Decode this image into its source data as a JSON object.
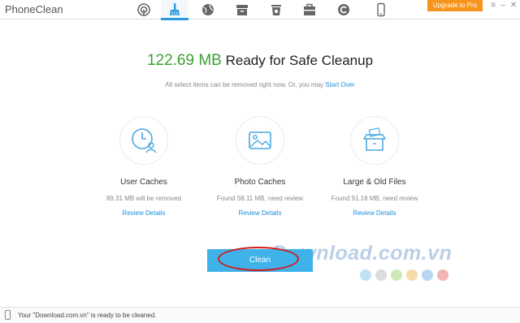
{
  "app": {
    "title": "PhoneClean",
    "upgrade_label": "Upgrade to Pro",
    "window_buttons": {
      "menu": "≡",
      "minimize": "–",
      "close": "✕"
    }
  },
  "toolbar": {
    "icons": [
      {
        "name": "scan-icon",
        "active": false
      },
      {
        "name": "broom-icon",
        "active": true
      },
      {
        "name": "globe-icon",
        "active": false
      },
      {
        "name": "archive-icon",
        "active": false
      },
      {
        "name": "trash-icon",
        "active": false
      },
      {
        "name": "toolbox-icon",
        "active": false
      },
      {
        "name": "refresh-icon",
        "active": false
      },
      {
        "name": "phone-icon",
        "active": false
      }
    ],
    "accent": "#2a9be0"
  },
  "summary": {
    "size": "122.69 MB",
    "headline": "Ready for Safe Cleanup",
    "subline": "All select items can be removed right now. Or, you may",
    "start_over": "Start Over",
    "size_color": "#3aa02f"
  },
  "categories": [
    {
      "title": "User Caches",
      "desc": "89.31 MB will be removed",
      "link": "Review Details"
    },
    {
      "title": "Photo Caches",
      "desc": "Found 58.11 MB, need review",
      "link": "Review Details"
    },
    {
      "title": "Large & Old Files",
      "desc": "Found 91.18 MB, need review",
      "link": "Review Details"
    }
  ],
  "clean_button": {
    "label": "Clean",
    "color": "#3fb2ea"
  },
  "watermark": {
    "text": "Download.com.vn"
  },
  "status": {
    "text": "Your \"Download.com.vn\" is ready to be cleaned."
  }
}
